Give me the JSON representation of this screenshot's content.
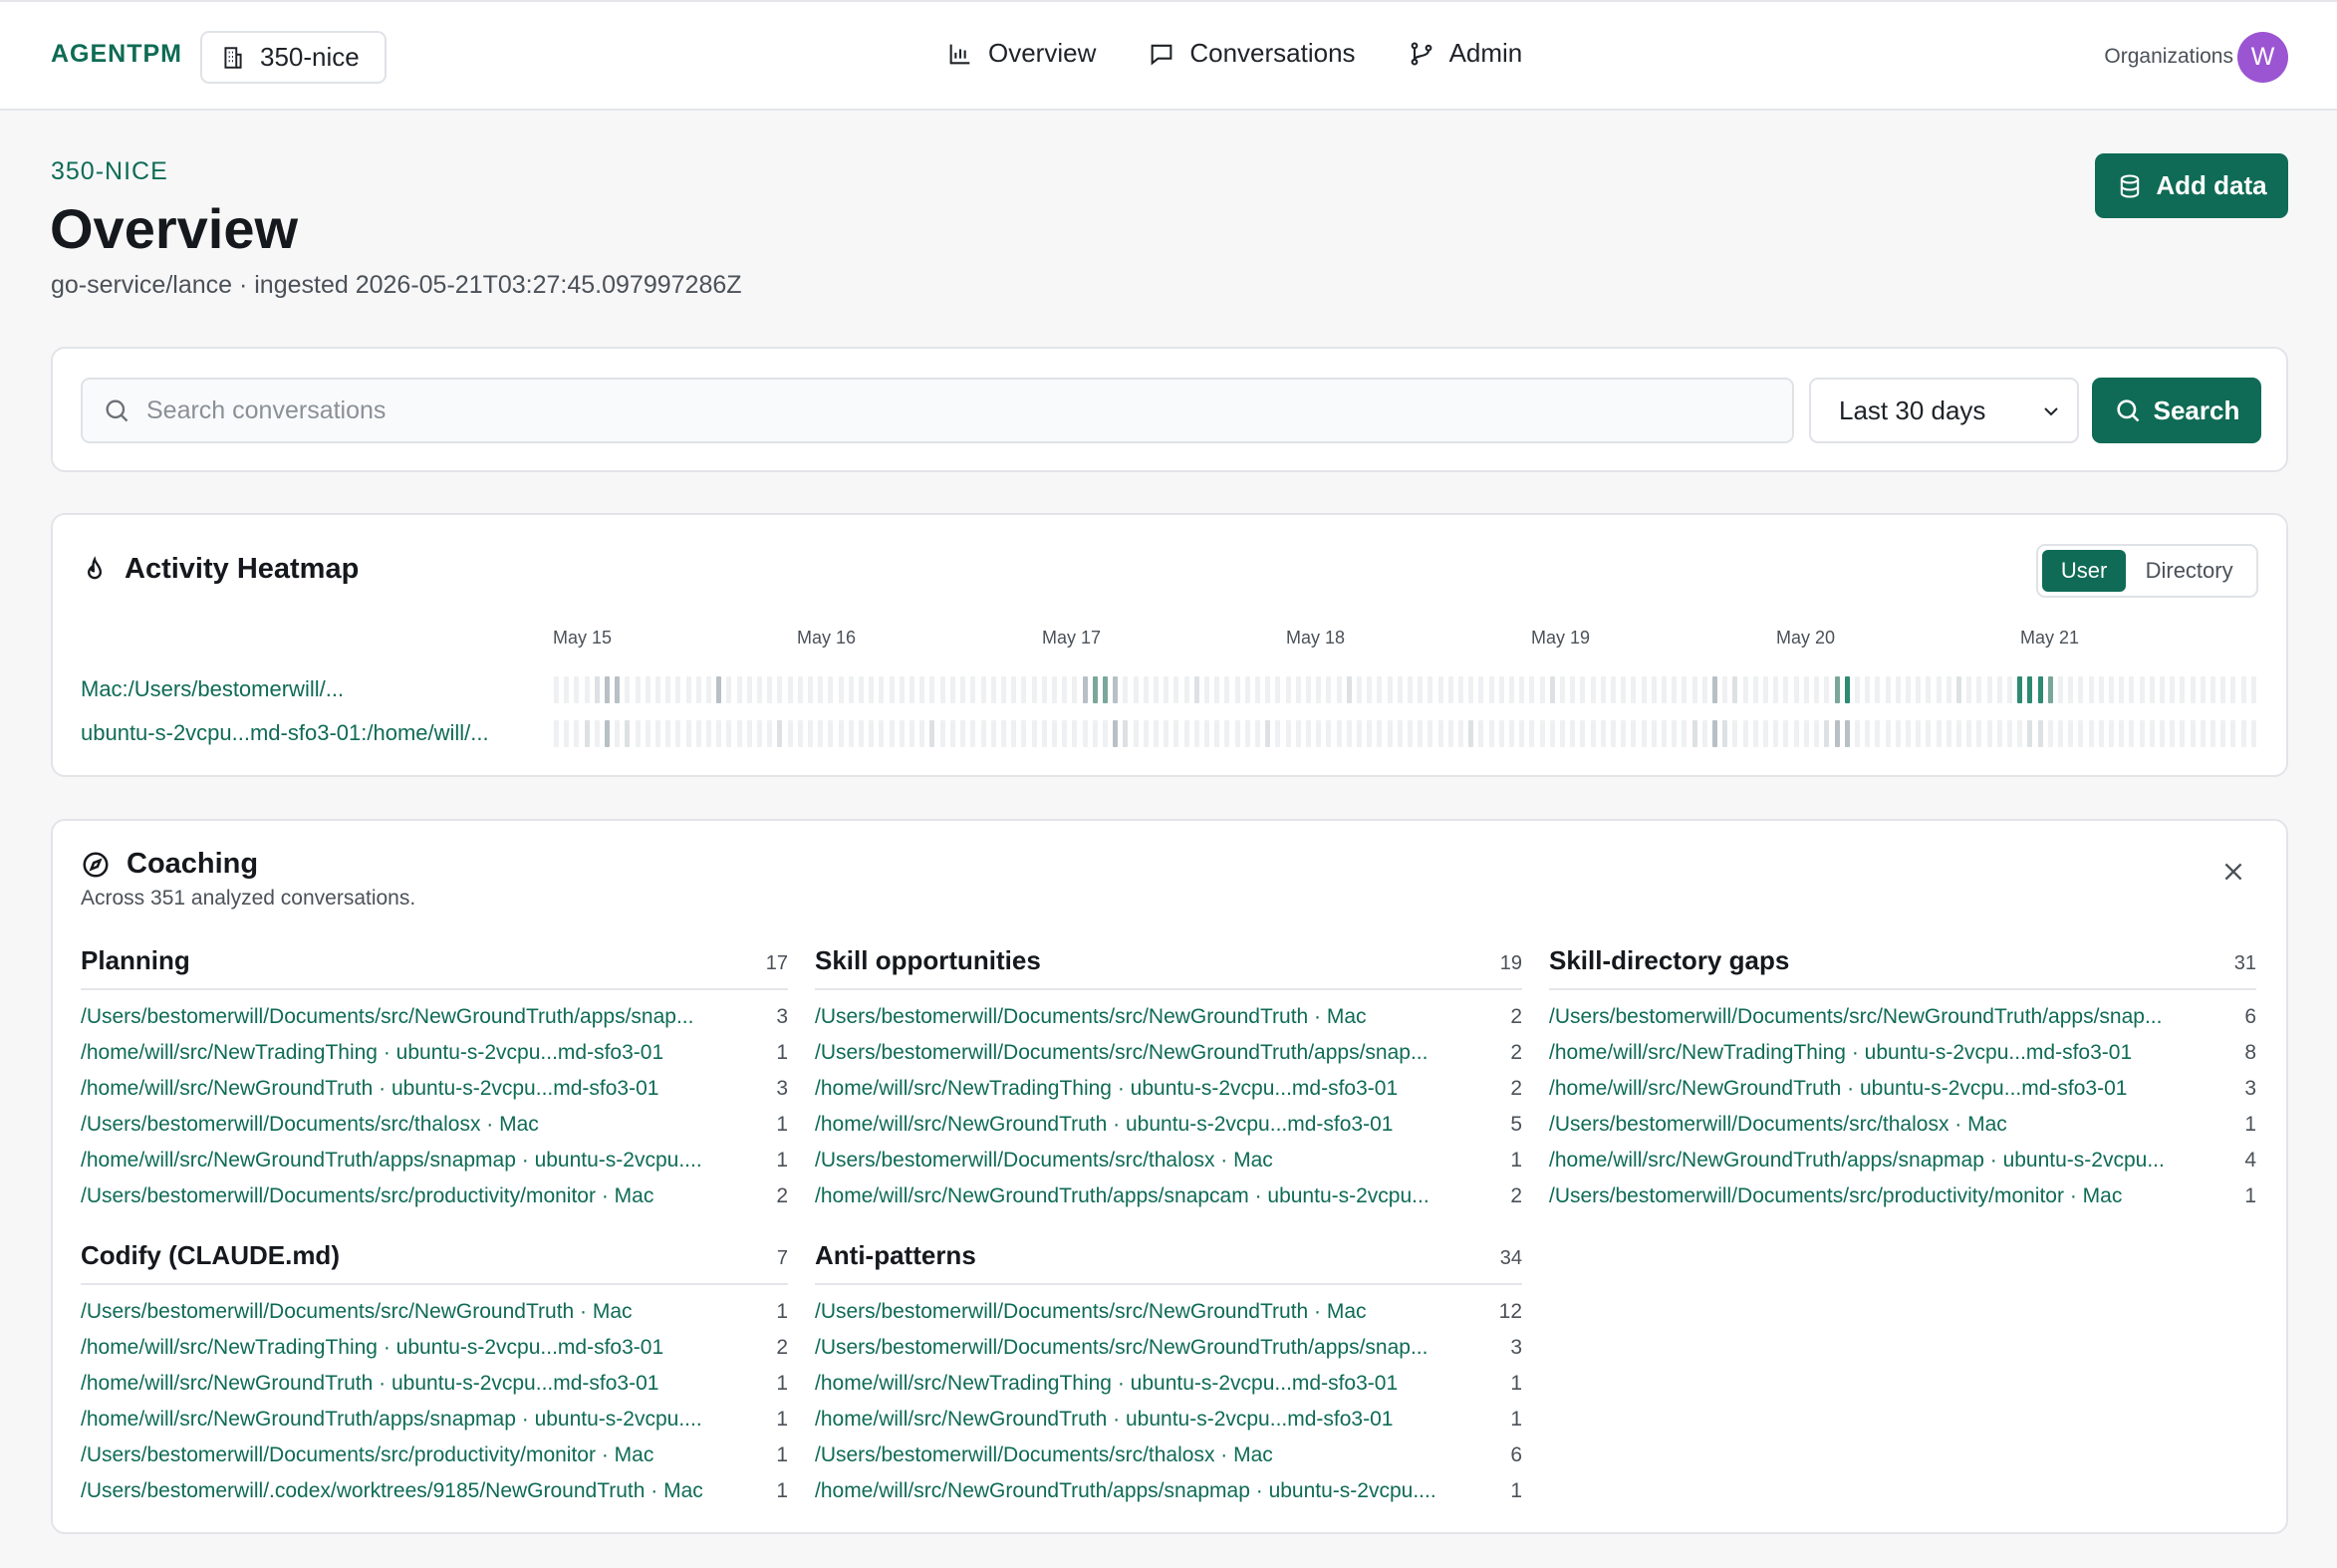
{
  "brand": "AGENTPM",
  "org_chip": "350-nice",
  "nav": [
    {
      "label": "Overview",
      "icon": "bar-chart-icon"
    },
    {
      "label": "Conversations",
      "icon": "chat-bubble-icon"
    },
    {
      "label": "Admin",
      "icon": "git-branch-icon"
    }
  ],
  "organizations_label": "Organizations",
  "avatar_initial": "W",
  "header": {
    "eyebrow": "350-NICE",
    "title": "Overview",
    "subtitle": "go-service/lance · ingested 2026-05-21T03:27:45.097997286Z",
    "add_data_label": "Add data"
  },
  "search": {
    "placeholder": "Search conversations",
    "range": "Last 30 days",
    "button": "Search"
  },
  "heatmap": {
    "title": "Activity Heatmap",
    "toggle": [
      "User",
      "Directory"
    ],
    "days": [
      "May 15",
      "May 16",
      "May 17",
      "May 18",
      "May 19",
      "May 20",
      "May 21"
    ],
    "rows": [
      {
        "label": "Mac:/Users/bestomerwill/..."
      },
      {
        "label": "ubuntu-s-2vcpu...md-sfo3-01:/home/will/..."
      }
    ],
    "colors": {
      "empty": "#eef0f2",
      "low": "#dde1e4",
      "mid": "#b8c0c6",
      "high": "#7aa79a",
      "max": "#2e8a72"
    }
  },
  "coaching": {
    "title": "Coaching",
    "subtitle": "Across 351 analyzed conversations.",
    "sections": [
      {
        "title": "Planning",
        "count": "17",
        "rows": [
          {
            "text": "/Users/bestomerwill/Documents/src/NewGroundTruth/apps/snap...",
            "n": "3"
          },
          {
            "text": "/home/will/src/NewTradingThing · ubuntu-s-2vcpu...md-sfo3-01",
            "n": "1"
          },
          {
            "text": "/home/will/src/NewGroundTruth · ubuntu-s-2vcpu...md-sfo3-01",
            "n": "3"
          },
          {
            "text": "/Users/bestomerwill/Documents/src/thalosx · Mac",
            "n": "1"
          },
          {
            "text": "/home/will/src/NewGroundTruth/apps/snapmap · ubuntu-s-2vcpu....",
            "n": "1"
          },
          {
            "text": "/Users/bestomerwill/Documents/src/productivity/monitor · Mac",
            "n": "2"
          }
        ]
      },
      {
        "title": "Skill opportunities",
        "count": "19",
        "rows": [
          {
            "text": "/Users/bestomerwill/Documents/src/NewGroundTruth · Mac",
            "n": "2"
          },
          {
            "text": "/Users/bestomerwill/Documents/src/NewGroundTruth/apps/snap...",
            "n": "2"
          },
          {
            "text": "/home/will/src/NewTradingThing · ubuntu-s-2vcpu...md-sfo3-01",
            "n": "2"
          },
          {
            "text": "/home/will/src/NewGroundTruth · ubuntu-s-2vcpu...md-sfo3-01",
            "n": "5"
          },
          {
            "text": "/Users/bestomerwill/Documents/src/thalosx · Mac",
            "n": "1"
          },
          {
            "text": "/home/will/src/NewGroundTruth/apps/snapcam · ubuntu-s-2vcpu...",
            "n": "2"
          }
        ]
      },
      {
        "title": "Skill-directory gaps",
        "count": "31",
        "rows": [
          {
            "text": "/Users/bestomerwill/Documents/src/NewGroundTruth/apps/snap...",
            "n": "6"
          },
          {
            "text": "/home/will/src/NewTradingThing · ubuntu-s-2vcpu...md-sfo3-01",
            "n": "8"
          },
          {
            "text": "/home/will/src/NewGroundTruth · ubuntu-s-2vcpu...md-sfo3-01",
            "n": "3"
          },
          {
            "text": "/Users/bestomerwill/Documents/src/thalosx · Mac",
            "n": "1"
          },
          {
            "text": "/home/will/src/NewGroundTruth/apps/snapmap · ubuntu-s-2vcpu...",
            "n": "4"
          },
          {
            "text": "/Users/bestomerwill/Documents/src/productivity/monitor · Mac",
            "n": "1"
          }
        ]
      },
      {
        "title": "Codify (CLAUDE.md)",
        "count": "7",
        "rows": [
          {
            "text": "/Users/bestomerwill/Documents/src/NewGroundTruth · Mac",
            "n": "1"
          },
          {
            "text": "/home/will/src/NewTradingThing · ubuntu-s-2vcpu...md-sfo3-01",
            "n": "2"
          },
          {
            "text": "/home/will/src/NewGroundTruth · ubuntu-s-2vcpu...md-sfo3-01",
            "n": "1"
          },
          {
            "text": "/home/will/src/NewGroundTruth/apps/snapmap · ubuntu-s-2vcpu....",
            "n": "1"
          },
          {
            "text": "/Users/bestomerwill/Documents/src/productivity/monitor · Mac",
            "n": "1"
          },
          {
            "text": "/Users/bestomerwill/.codex/worktrees/9185/NewGroundTruth · Mac",
            "n": "1"
          }
        ]
      },
      {
        "title": "Anti-patterns",
        "count": "34",
        "rows": [
          {
            "text": "/Users/bestomerwill/Documents/src/NewGroundTruth · Mac",
            "n": "12"
          },
          {
            "text": "/Users/bestomerwill/Documents/src/NewGroundTruth/apps/snap...",
            "n": "3"
          },
          {
            "text": "/home/will/src/NewTradingThing · ubuntu-s-2vcpu...md-sfo3-01",
            "n": "1"
          },
          {
            "text": "/home/will/src/NewGroundTruth · ubuntu-s-2vcpu...md-sfo3-01",
            "n": "1"
          },
          {
            "text": "/Users/bestomerwill/Documents/src/thalosx · Mac",
            "n": "6"
          },
          {
            "text": "/home/will/src/NewGroundTruth/apps/snapmap · ubuntu-s-2vcpu....",
            "n": "1"
          }
        ]
      }
    ]
  },
  "colors": {
    "accent": "#0f6b55",
    "avatar": "#9b55d3"
  }
}
